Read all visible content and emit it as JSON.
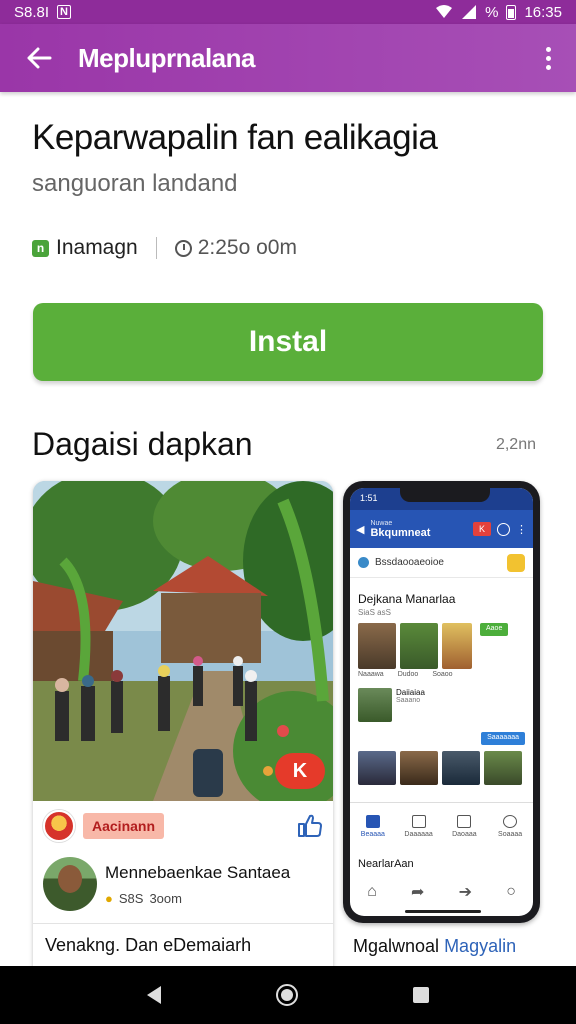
{
  "status_bar": {
    "carrier": "S8.8I",
    "notification_badge": "N",
    "battery_text": "%",
    "time": "16:35"
  },
  "app_bar": {
    "title": "Mepluprnalana"
  },
  "app": {
    "title": "Keparwapalin fan ealikagia",
    "subtitle": "sanguoran landand",
    "developer": "Inamagn",
    "size_or_time": "2:25o o0m",
    "install_label": "Instal"
  },
  "screenshots_section": {
    "title": "Dagaisi dapkan",
    "count": "2,2nn"
  },
  "card1": {
    "fab_label": "K",
    "tag_label": "Aacinann",
    "author_name": "Mennebaenkae Santaea",
    "author_rating": "S8S",
    "author_meta": "3oom",
    "caption": "Venakng. Dan eDemaiarh"
  },
  "phone": {
    "status_time": "1:51",
    "appbar_title": "Bkqumneat",
    "appbar_prefix": "Nuwae",
    "search_text": "Bssdaooaeoioe",
    "heading": "Dejkana Manarlaa",
    "heading_sub": "SiaS asS",
    "thumb_captions": [
      "Naaawa",
      "Dudoo",
      "Soaoo"
    ],
    "green_button": "Aaoe",
    "item_title": "Daiiaiaa",
    "item_sub": "Saaano",
    "blue_button": "Saaaaaaa",
    "tabs": [
      "Beaaaa",
      "Daaaaaa",
      "Daoaaa",
      "Soaaaa"
    ],
    "section2": "NearlarAan",
    "caption_prefix": "Mgalwnoal",
    "caption_highlight": "Magyalin"
  },
  "colors": {
    "appbar": "#9a36a8",
    "install": "#5aaf3a",
    "phone_primary": "#2755b4",
    "tag_red": "#e53a2a"
  }
}
